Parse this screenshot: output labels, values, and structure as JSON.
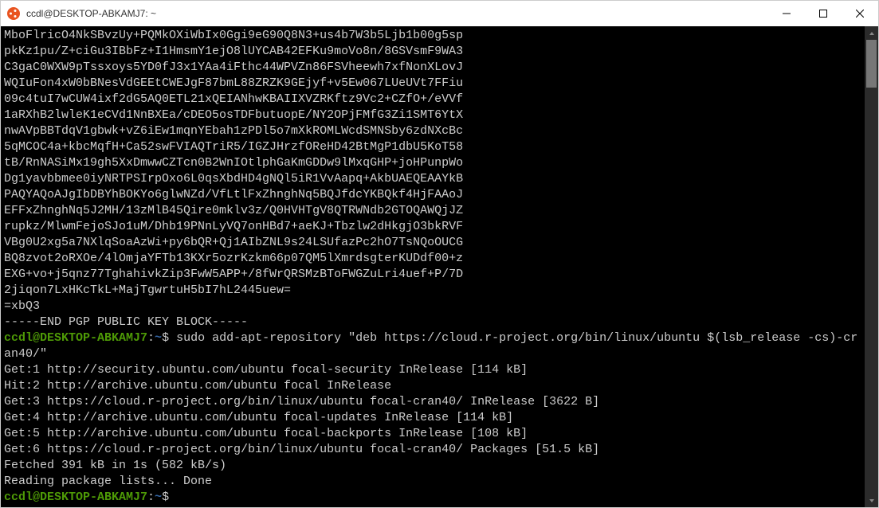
{
  "window": {
    "title": "ccdl@DESKTOP-ABKAMJ7: ~"
  },
  "terminal": {
    "key_block": [
      "MboFlricO4NkSBvzUy+PQMkOXiWbIx0Ggi9eG90Q8N3+us4b7W3b5Ljb1b00g5sp",
      "pkKz1pu/Z+ciGu3IBbFz+I1HmsmY1ejO8lUYCAB42EFKu9moVo8n/8GSVsmF9WA3",
      "C3gaC0WXW9pTssxoys5YD0fJ3x1YAa4iFthc44WPVZn86FSVheewh7xfNonXLovJ",
      "WQIuFon4xW0bBNesVdGEEtCWEJgF87bmL88ZRZK9GEjyf+v5Ew067LUeUVt7FFiu",
      "09c4tuI7wCUW4ixf2dG5AQ0ETL21xQEIANhwKBAIIXVZRKftz9Vc2+CZfO+/eVVf",
      "1aRXhB2lwleK1eCVd1NnBXEa/cDEO5osTDFbutuopE/NY2OPjFMfG3Zi1SMT6YtX",
      "nwAVpBBTdqV1gbwk+vZ6iEw1mqnYEbah1zPDl5o7mXkROMLWcdSMNSby6zdNXcBc",
      "5qMCOC4a+kbcMqfH+Ca52swFVIAQTriR5/IGZJHrzfOReHD42BtMgP1dbU5KoT58",
      "tB/RnNASiMx19gh5XxDmwwCZTcn0B2WnIOtlphGaKmGDDw9lMxqGHP+joHPunpWo",
      "Dg1yavbbmee0iyNRTPSIrpOxo6L0qsXbdHD4gNQl5iR1VvAapq+AkbUAEQEAAYkB",
      "PAQYAQoAJgIbDBYhBOKYo6glwNZd/VfLtlFxZhnghNq5BQJfdcYKBQkf4HjFAAoJ",
      "EFFxZhnghNq5J2MH/13zMlB45Qire0mklv3z/Q0HVHTgV8QTRWNdb2GTOQAWQjJZ",
      "rupkz/MlwmFejoSJo1uM/Dhb19PNnLyVQ7onHBd7+aeKJ+Tbzlw2dHkgjO3bkRVF",
      "VBg0U2xg5a7NXlqSoaAzWi+py6bQR+Qj1AIbZNL9s24LSUfazPc2hO7TsNQoOUCG",
      "BQ8zvot2oRXOe/4lOmjaYFTb13KXr5ozrKzkm66p07QM5lXmrdsgterKUDdf00+z",
      "EXG+vo+j5qnz77TghahivkZip3FwW5APP+/8fWrQRSMzBToFWGZuLri4uef+P/7D",
      "2jiqon7LxHKcTkL+MajTgwrtuH5bI7hL2445uew=",
      "=xbQ3",
      "-----END PGP PUBLIC KEY BLOCK-----"
    ],
    "prompt1_user": "ccdl@DESKTOP-ABKAMJ7",
    "prompt1_path": "~",
    "prompt1_sep": ":",
    "prompt1_dollar": "$",
    "command1": " sudo add-apt-repository \"deb https://cloud.r-project.org/bin/linux/ubuntu $(lsb_release -cs)-cran40/\"",
    "output": [
      "Get:1 http://security.ubuntu.com/ubuntu focal-security InRelease [114 kB]",
      "Hit:2 http://archive.ubuntu.com/ubuntu focal InRelease",
      "Get:3 https://cloud.r-project.org/bin/linux/ubuntu focal-cran40/ InRelease [3622 B]",
      "Get:4 http://archive.ubuntu.com/ubuntu focal-updates InRelease [114 kB]",
      "Get:5 http://archive.ubuntu.com/ubuntu focal-backports InRelease [108 kB]",
      "Get:6 https://cloud.r-project.org/bin/linux/ubuntu focal-cran40/ Packages [51.5 kB]",
      "Fetched 391 kB in 1s (582 kB/s)",
      "Reading package lists... Done"
    ],
    "prompt2_user": "ccdl@DESKTOP-ABKAMJ7",
    "prompt2_path": "~",
    "prompt2_sep": ":",
    "prompt2_dollar": "$"
  }
}
